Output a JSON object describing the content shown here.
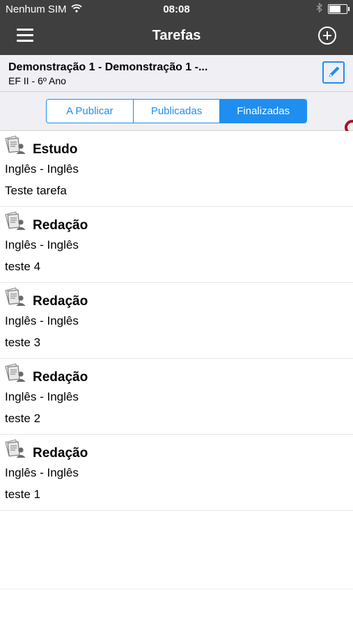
{
  "status_bar": {
    "carrier": "Nenhum SIM",
    "time": "08:08",
    "wifi_icon": "wifi-icon",
    "bluetooth_icon": "bluetooth-icon",
    "battery_icon": "battery-icon"
  },
  "nav": {
    "title": "Tarefas",
    "menu_icon": "hamburger-menu-icon",
    "add_icon": "plus-circle-icon"
  },
  "class_header": {
    "title": "Demonstração 1 - Demonstração 1 -...",
    "subtitle": "EF II - 6º Ano",
    "edit_icon": "edit-pencil-icon"
  },
  "tabs": [
    {
      "label": "A Publicar",
      "selected": false
    },
    {
      "label": "Publicadas",
      "selected": false
    },
    {
      "label": "Finalizadas",
      "selected": true
    }
  ],
  "tasks": [
    {
      "type": "Estudo",
      "subject": "Inglês - Inglês",
      "name": "Teste tarefa",
      "icon": "task-assignment-icon"
    },
    {
      "type": "Redação",
      "subject": "Inglês - Inglês",
      "name": "teste 4",
      "icon": "task-assignment-icon"
    },
    {
      "type": "Redação",
      "subject": "Inglês - Inglês",
      "name": "teste 3",
      "icon": "task-assignment-icon"
    },
    {
      "type": "Redação",
      "subject": "Inglês - Inglês",
      "name": "teste 2",
      "icon": "task-assignment-icon"
    },
    {
      "type": "Redação",
      "subject": "Inglês - Inglês",
      "name": "teste 1",
      "icon": "task-assignment-icon"
    }
  ],
  "colors": {
    "accent": "#1f8ef1",
    "bar": "#3f3f3f",
    "header_bg": "#efeff4"
  }
}
